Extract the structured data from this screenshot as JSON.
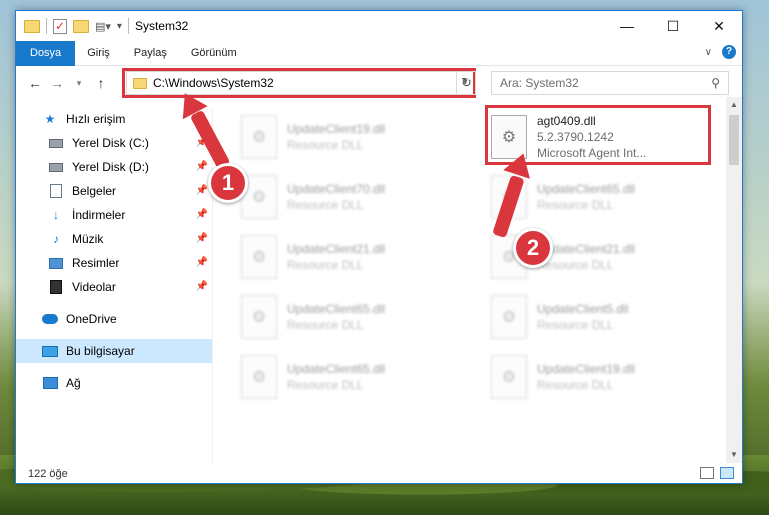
{
  "window": {
    "title": "System32",
    "controls": {
      "minimize": "—",
      "maximize": "☐",
      "close": "✕"
    }
  },
  "ribbon": {
    "tabs": [
      {
        "label": "Dosya",
        "active": true
      },
      {
        "label": "Giriş"
      },
      {
        "label": "Paylaş"
      },
      {
        "label": "Görünüm"
      }
    ]
  },
  "navigation": {
    "address_path": "C:\\Windows\\System32",
    "search_placeholder": "Ara: System32"
  },
  "sidebar": {
    "quick_access": "Hızlı erişim",
    "items": [
      {
        "label": "Yerel Disk (C:)",
        "pinned": true,
        "icon": "drive-icon"
      },
      {
        "label": "Yerel Disk (D:)",
        "pinned": true,
        "icon": "drive-icon"
      },
      {
        "label": "Belgeler",
        "pinned": true,
        "icon": "documents-icon"
      },
      {
        "label": "İndirmeler",
        "pinned": true,
        "icon": "downloads-icon"
      },
      {
        "label": "Müzik",
        "pinned": true,
        "icon": "music-icon"
      },
      {
        "label": "Resimler",
        "pinned": true,
        "icon": "pictures-icon"
      },
      {
        "label": "Videolar",
        "pinned": true,
        "icon": "videos-icon"
      }
    ],
    "onedrive": "OneDrive",
    "this_pc": "Bu bilgisayar",
    "network": "Ağ"
  },
  "files": {
    "highlighted": {
      "name": "agt0409.dll",
      "version": "5.2.3790.1242",
      "description": "Microsoft Agent Int..."
    },
    "left_column": [
      {
        "name": "UpdateClient19.dll",
        "desc": "Resource DLL"
      },
      {
        "name": "UpdateClient70.dll",
        "desc": "Resource DLL"
      },
      {
        "name": "UpdateClient21.dll",
        "desc": "Resource DLL"
      },
      {
        "name": "UpdateClient65.dll",
        "desc": "Resource DLL"
      },
      {
        "name": "UpdateClient65.dll",
        "desc": "Resource DLL"
      }
    ],
    "right_column": [
      {
        "name": "UpdateClient65.dll",
        "desc": "Resource DLL"
      },
      {
        "name": "UpdateClient21.dll",
        "desc": "Resource DLL"
      },
      {
        "name": "UpdateClient5.dll",
        "desc": "Resource DLL"
      },
      {
        "name": "UpdateClient19.dll",
        "desc": "Resource DLL"
      }
    ]
  },
  "status": {
    "item_count": "122 öğe"
  },
  "callouts": {
    "one": "1",
    "two": "2"
  },
  "colors": {
    "accent": "#1979ca",
    "callout_red": "#d9363e",
    "selection": "#cce8ff"
  }
}
